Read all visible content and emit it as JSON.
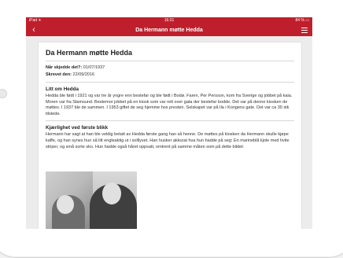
{
  "status_bar": {
    "carrier": "iPad ✈",
    "time": "16:31",
    "battery": "84 % ▭"
  },
  "nav": {
    "back_icon": "chevron-left-icon",
    "title": "Da Hermann møtte Hedda",
    "menu_icon": "hamburger-menu-icon"
  },
  "article": {
    "title": "Da Hermann møtte Hedda",
    "when_label": "Når skjedde det?:",
    "when_value": "01/07/1937",
    "written_label": "Skrevet den:",
    "written_value": "22/09/2016",
    "sections": [
      {
        "heading": "Litt om Hedda",
        "body": "Hedda ble født i 1921 og var tre år yngre enn bestefar og ble født i Bodø. Faren, Per Persson, kom fra Sverige og jobbet på kaia. Moren var fra Stamsund.  Bestemor jobbet på en kiosk som var rett over gata der bestefar bodde. Det var på denne kiosken de møttes. I 1937 ble de sammen. I 1953 giftet de seg hjemme hos presten. Selskapet var på Ila i Kongens gate. Det var ca 30 stk tilstede."
      },
      {
        "heading": "Kjærlighet ved første blikk",
        "body": "Hermann har sagt at han ble veldig betatt av Hedda første gang han så henne. De møttes på kiosken da Hermann skulle kjøpe kaffe, og han synes hun så litt englеaktig ut i solllyset. Han husker akkurat hva hun hadde på seg: En marineblå kjole med hvite striper, og små sorte sko. Hun hadde også håret oppsatt, omtrent på samme måten som på dette bildet:"
      }
    ]
  },
  "colors": {
    "accent": "#bf1f2c",
    "card": "#ffffff",
    "background": "#ececec"
  }
}
